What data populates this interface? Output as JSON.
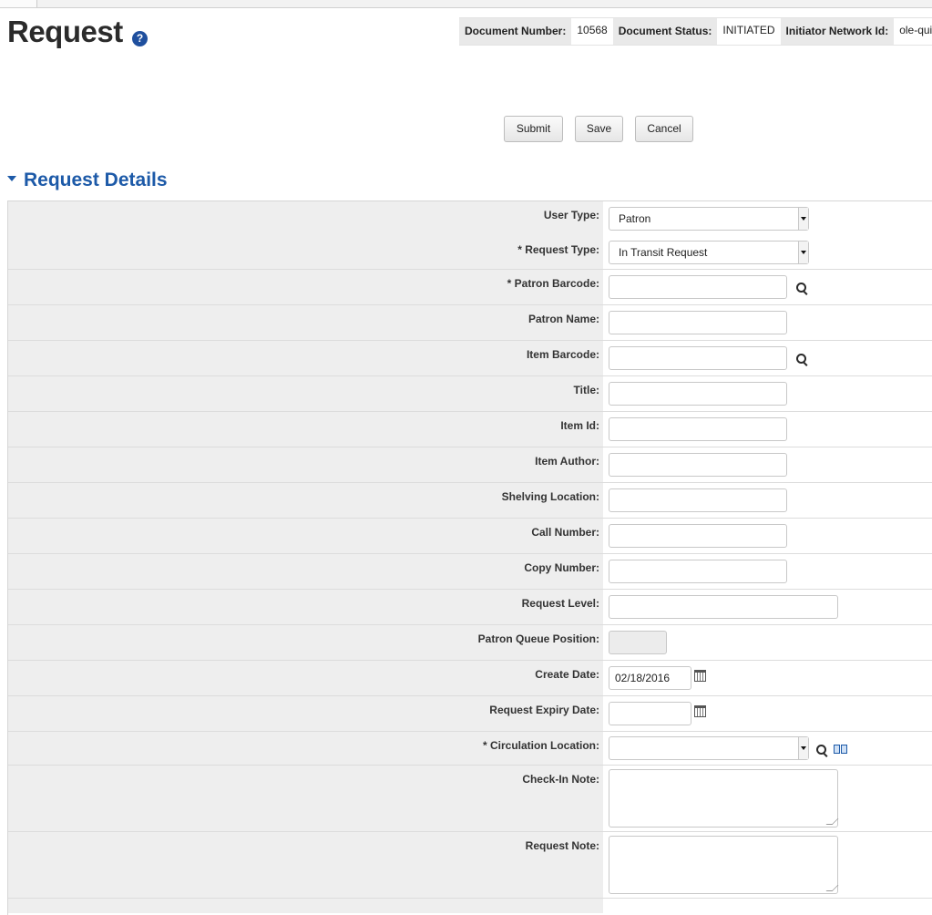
{
  "page": {
    "title": "Request",
    "help_icon": "question-mark-icon"
  },
  "document_info": {
    "number_label": "Document Number:",
    "number_value": "10568",
    "status_label": "Document Status:",
    "status_value": "INITIATED",
    "initiator_label": "Initiator Network Id:",
    "initiator_value": "ole-quic"
  },
  "actions": {
    "submit": "Submit",
    "save": "Save",
    "cancel": "Cancel"
  },
  "section": {
    "title": "Request Details"
  },
  "form": {
    "user_type": {
      "label": "User Type:",
      "value": "Patron"
    },
    "request_type": {
      "label": "* Request Type:",
      "value": "In Transit Request"
    },
    "patron_barcode": {
      "label": "* Patron Barcode:",
      "value": ""
    },
    "patron_name": {
      "label": "Patron Name:",
      "value": ""
    },
    "item_barcode": {
      "label": "Item Barcode:",
      "value": ""
    },
    "title": {
      "label": "Title:",
      "value": ""
    },
    "item_id": {
      "label": "Item Id:",
      "value": ""
    },
    "item_author": {
      "label": "Item Author:",
      "value": ""
    },
    "shelving_location": {
      "label": "Shelving Location:",
      "value": ""
    },
    "call_number": {
      "label": "Call Number:",
      "value": ""
    },
    "copy_number": {
      "label": "Copy Number:",
      "value": ""
    },
    "request_level": {
      "label": "Request Level:",
      "value": ""
    },
    "patron_queue_position": {
      "label": "Patron Queue Position:",
      "value": ""
    },
    "create_date": {
      "label": "Create Date:",
      "value": "02/18/2016"
    },
    "request_expiry_date": {
      "label": "Request Expiry Date:",
      "value": ""
    },
    "circulation_location": {
      "label": "* Circulation Location:",
      "value": ""
    },
    "check_in_note": {
      "label": "Check-In Note:",
      "value": ""
    },
    "request_note": {
      "label": "Request Note:",
      "value": ""
    }
  },
  "icons": {
    "search": "magnifier-icon",
    "calendar": "calendar-icon",
    "book": "book-icon"
  }
}
